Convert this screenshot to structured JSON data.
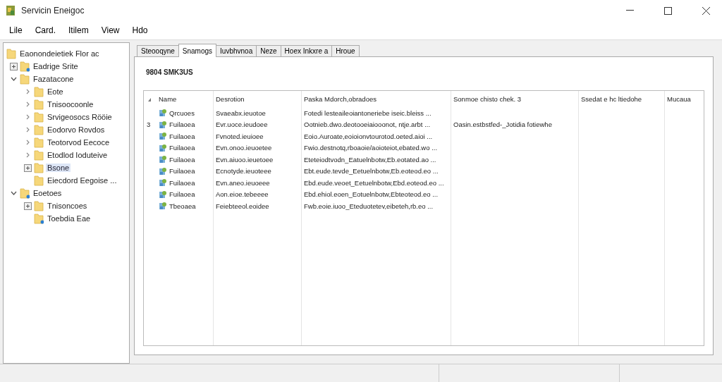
{
  "window": {
    "title": "Servicin Eneigoc"
  },
  "menu": [
    "Lile",
    "Card.",
    "Itilem",
    "View",
    "Hdo"
  ],
  "tree": [
    {
      "label": "Eaonondeietiek Flor ac",
      "badge": false,
      "selected": false,
      "children": [
        {
          "label": "Eadrige Srite",
          "kind": "box",
          "badge": true,
          "selected": false
        },
        {
          "label": "Fazatacone",
          "kind": "open",
          "badge": false,
          "selected": false,
          "children": [
            {
              "label": "Eote",
              "kind": "closed",
              "badge": false,
              "selected": false
            },
            {
              "label": "Tnisoocoonle",
              "kind": "closed",
              "badge": false,
              "selected": false
            },
            {
              "label": "Srvigeosocs Rööie",
              "kind": "closed",
              "badge": false,
              "selected": false
            },
            {
              "label": "Eodorvo Rovdos",
              "kind": "closed",
              "badge": false,
              "selected": false
            },
            {
              "label": "Teotorvod Eecoce",
              "kind": "closed",
              "badge": false,
              "selected": false
            },
            {
              "label": "Etodlod Ioduteive",
              "kind": "closed",
              "badge": false,
              "selected": false
            },
            {
              "label": "Bsone",
              "kind": "box",
              "badge": false,
              "selected": true
            },
            {
              "label": "Eiecdord Eegoise ...",
              "kind": "none",
              "badge": false,
              "selected": false
            }
          ]
        },
        {
          "label": "Eoetoes",
          "kind": "open",
          "badge": true,
          "selected": false,
          "children": [
            {
              "label": "Tnisoncoes",
              "kind": "box",
              "badge": false,
              "selected": false
            },
            {
              "label": "Toebdia Eae",
              "kind": "none",
              "badge": true,
              "selected": false
            }
          ]
        }
      ]
    }
  ],
  "tabs": [
    {
      "label": "Steooqyne",
      "selected": false
    },
    {
      "label": "Snamogs",
      "selected": true
    },
    {
      "label": "Iuvbhvnoa",
      "selected": false
    },
    {
      "label": "Neze",
      "selected": false
    },
    {
      "label": "Hoex Inkxre a",
      "selected": false
    },
    {
      "label": "Hroue",
      "selected": false
    }
  ],
  "heading": "9804 SMK3US",
  "table": {
    "columns": [
      "Name",
      "Desrotion",
      "Paska Mdorch,obradoes",
      "Sonmoe chisto chek. 3",
      "Ssedat e hc ltiedohe",
      "Mucaua"
    ],
    "rows": [
      {
        "marker": "",
        "cells": [
          "Qrcuoes",
          "Svaeabx.ieuotoe",
          "Fotedi lesteaileoiantoneriebe iseic.bleiss ...",
          "",
          "",
          ""
        ]
      },
      {
        "marker": "3",
        "cells": [
          "Fuilaoea",
          "Evr.uoce.ieudoee",
          "Ootnieb.dwo.deotooeiaiooonot, ntje.arbt ...",
          "Oasin.estbstfed-_Jotidia fotiewhe",
          "",
          ""
        ]
      },
      {
        "marker": "",
        "cells": [
          "Fuilaoea",
          "Fvnoted.ieuioee",
          "Eoio.Auroate,eoioionvtourotod.oeted.aioi ...",
          "",
          "",
          ""
        ]
      },
      {
        "marker": "",
        "cells": [
          "Fuilaoea",
          "Evn.onoo.ieuoetee",
          "Fwio.destnotq,rboaoie/aoioteiot,ebated.wo ...",
          "",
          "",
          ""
        ]
      },
      {
        "marker": "",
        "cells": [
          "Fuilaoea",
          "Evn.aiuoo.ieuetoee",
          "Eteteiodtvodn_Eatuelnbotw,Eb.eotated.ao ...",
          "",
          "",
          ""
        ]
      },
      {
        "marker": "",
        "cells": [
          "Fuilaoea",
          "Ecnotyde.ieuoteee",
          "Ebt.eude.tevde_Eetuelnbotw,Eb.eoteod.eo ...",
          "",
          "",
          ""
        ]
      },
      {
        "marker": "",
        "cells": [
          "Fuilaoea",
          "Evn.aneo.ieuoeee",
          "Ebd.eude.veoet_Eetuelnbotw,Ebd.eoteod.eo ...",
          "",
          "",
          ""
        ]
      },
      {
        "marker": "",
        "cells": [
          "Fuilaoea",
          "Aon.eioe.tebeeee",
          "Ebd.ehiol.eoen_Eotuelnbotw,Ebteoteod.eo ...",
          "",
          "",
          ""
        ]
      },
      {
        "marker": "",
        "cells": [
          "Tbeoaea",
          "Feiebteeol.eoidee",
          "Fwb.eoie.iuoo_Eteduotetev,eibeteh,rb.eo ...",
          "",
          "",
          ""
        ]
      }
    ]
  }
}
